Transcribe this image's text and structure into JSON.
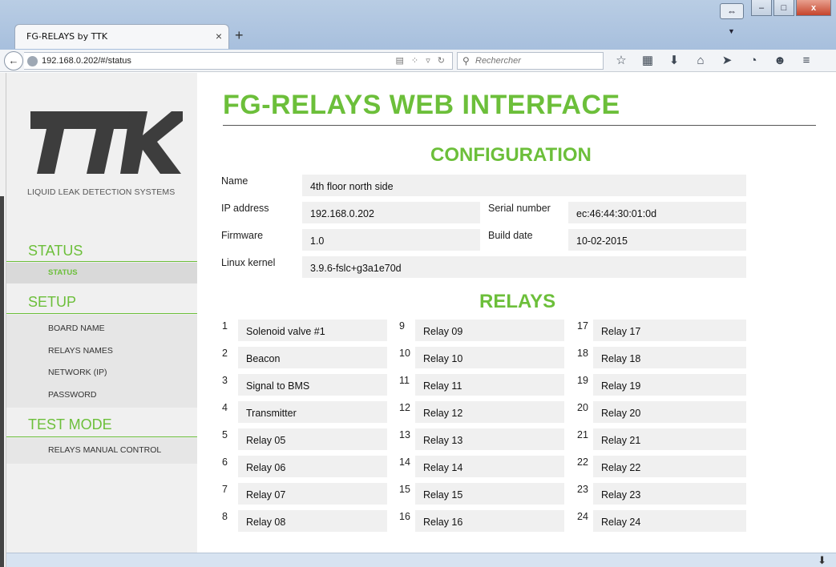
{
  "browser": {
    "tab_title": "FG-RELAYS by TTK",
    "tab_close": "×",
    "new_tab": "+",
    "url": "192.168.0.202/#/status",
    "search_placeholder": "Rechercher",
    "window_buttons": {
      "minimize": "–",
      "maximize": "□",
      "close": "x"
    }
  },
  "sidebar": {
    "logo_text": "TTK",
    "tagline": "LIQUID LEAK DETECTION SYSTEMS",
    "status_head": "STATUS",
    "status_item": "STATUS",
    "setup_head": "SETUP",
    "setup_items": [
      "BOARD NAME",
      "RELAYS NAMES",
      "NETWORK (IP)",
      "PASSWORD"
    ],
    "test_head": "TEST MODE",
    "test_items": [
      "RELAYS MANUAL CONTROL"
    ]
  },
  "main": {
    "title": "FG-RELAYS WEB INTERFACE",
    "config_title": "CONFIGURATION",
    "config": {
      "name_label": "Name",
      "name_value": "4th floor north side",
      "ip_label": "IP address",
      "ip_value": "192.168.0.202",
      "serial_label": "Serial number",
      "serial_value": "ec:46:44:30:01:0d",
      "firmware_label": "Firmware",
      "firmware_value": "1.0",
      "build_label": "Build date",
      "build_value": "10-02-2015",
      "kernel_label": "Linux kernel",
      "kernel_value": "3.9.6-fslc+g3a1e70d"
    },
    "relays_title": "RELAYS",
    "relays": [
      {
        "num": "1",
        "name": "Solenoid valve #1"
      },
      {
        "num": "2",
        "name": "Beacon"
      },
      {
        "num": "3",
        "name": "Signal to BMS"
      },
      {
        "num": "4",
        "name": "Transmitter"
      },
      {
        "num": "5",
        "name": "Relay 05"
      },
      {
        "num": "6",
        "name": "Relay 06"
      },
      {
        "num": "7",
        "name": "Relay 07"
      },
      {
        "num": "8",
        "name": "Relay 08"
      },
      {
        "num": "9",
        "name": "Relay 09"
      },
      {
        "num": "10",
        "name": "Relay 10"
      },
      {
        "num": "11",
        "name": "Relay 11"
      },
      {
        "num": "12",
        "name": "Relay 12"
      },
      {
        "num": "13",
        "name": "Relay 13"
      },
      {
        "num": "14",
        "name": "Relay 14"
      },
      {
        "num": "15",
        "name": "Relay 15"
      },
      {
        "num": "16",
        "name": "Relay 16"
      },
      {
        "num": "17",
        "name": "Relay 17"
      },
      {
        "num": "18",
        "name": "Relay 18"
      },
      {
        "num": "19",
        "name": "Relay 19"
      },
      {
        "num": "20",
        "name": "Relay 20"
      },
      {
        "num": "21",
        "name": "Relay 21"
      },
      {
        "num": "22",
        "name": "Relay 22"
      },
      {
        "num": "23",
        "name": "Relay 23"
      },
      {
        "num": "24",
        "name": "Relay 24"
      }
    ]
  },
  "colors": {
    "accent": "#6cbf3a",
    "panel": "#f0f0f0"
  }
}
